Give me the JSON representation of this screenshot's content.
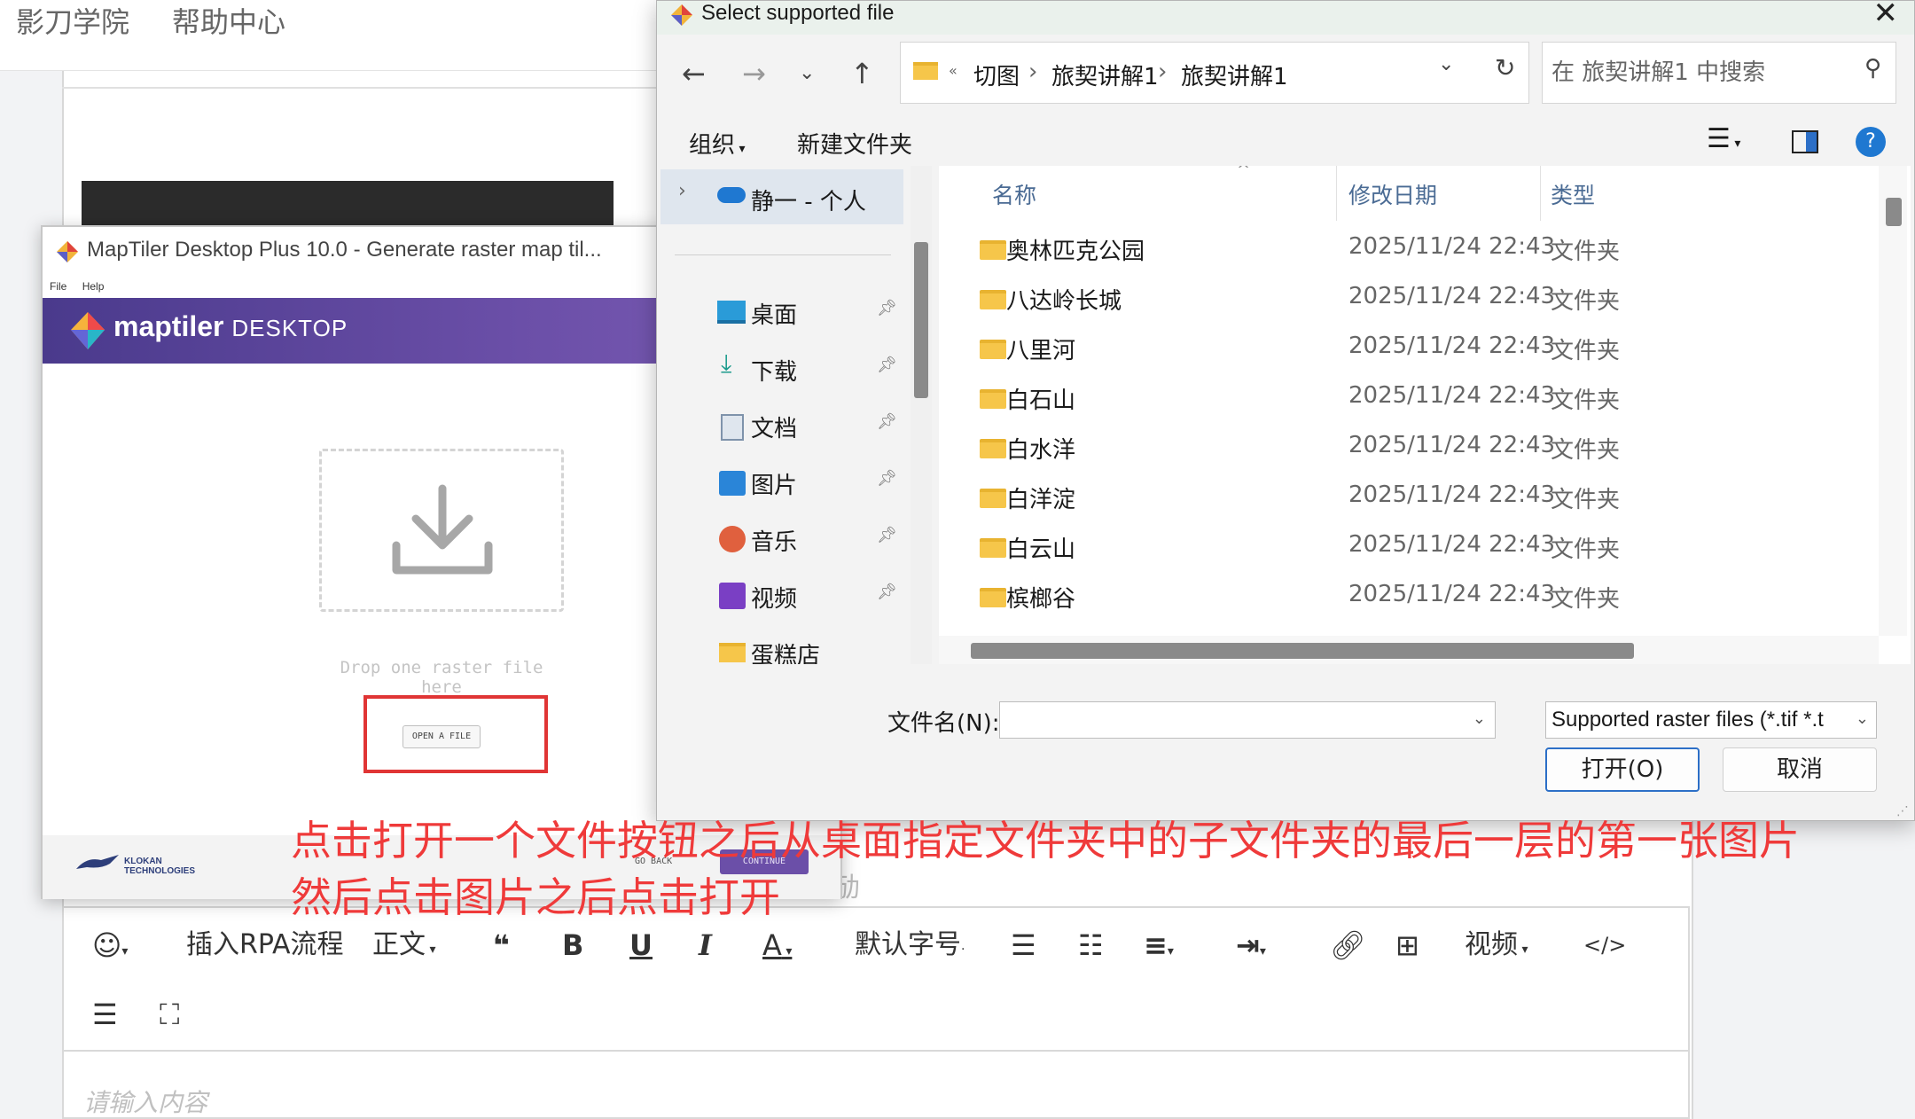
{
  "web": {
    "nav": [
      "影刀学院",
      "帮助中心"
    ],
    "editor_toolbar": {
      "emoji_icon": "smiley-icon",
      "insert_rpa": "插入RPA流程",
      "paragraph": "正文",
      "quote_icon": "❝",
      "bold": "B",
      "underline": "U",
      "italic": "I",
      "font_color": "A",
      "font_size": "默认字号",
      "video": "视频",
      "code": "</>"
    },
    "editor_placeholder": "请输入内容",
    "partial_text": "劢"
  },
  "maptiler": {
    "title": "MapTiler Desktop Plus 10.0 - Generate raster map til...",
    "menu": [
      "File",
      "Help"
    ],
    "brand": "maptiler",
    "brand_sub": "DESKTOP",
    "drop_text": "Drop one raster file here",
    "open_button": "OPEN A FILE",
    "vendor": "KLOKAN TECHNOLOGIES",
    "go_back": "GO BACK",
    "continue": "CONTINUE"
  },
  "dialog": {
    "title": "Select supported file",
    "breadcrumb": [
      "切图",
      "旅契讲解1",
      "旅契讲解1"
    ],
    "search_placeholder": "在 旅契讲解1 中搜索",
    "organize": "组织",
    "new_folder": "新建文件夹",
    "nav_pane": {
      "onedrive": "静一 - 个人",
      "items": [
        {
          "label": "桌面",
          "icon": "desktop-icon"
        },
        {
          "label": "下载",
          "icon": "download-icon"
        },
        {
          "label": "文档",
          "icon": "document-icon"
        },
        {
          "label": "图片",
          "icon": "pictures-icon"
        },
        {
          "label": "音乐",
          "icon": "music-icon"
        },
        {
          "label": "视频",
          "icon": "video-icon"
        },
        {
          "label": "蛋糕店",
          "icon": "folder-icon"
        }
      ]
    },
    "columns": [
      "名称",
      "修改日期",
      "类型"
    ],
    "rows": [
      {
        "name": "奥林匹克公园",
        "date": "2025/11/24 22:43",
        "type": "文件夹"
      },
      {
        "name": "八达岭长城",
        "date": "2025/11/24 22:43",
        "type": "文件夹"
      },
      {
        "name": "八里河",
        "date": "2025/11/24 22:43",
        "type": "文件夹"
      },
      {
        "name": "白石山",
        "date": "2025/11/24 22:43",
        "type": "文件夹"
      },
      {
        "name": "白水洋",
        "date": "2025/11/24 22:43",
        "type": "文件夹"
      },
      {
        "name": "白洋淀",
        "date": "2025/11/24 22:43",
        "type": "文件夹"
      },
      {
        "name": "白云山",
        "date": "2025/11/24 22:43",
        "type": "文件夹"
      },
      {
        "name": "槟榔谷",
        "date": "2025/11/24 22:43",
        "type": "文件夹"
      }
    ],
    "filename_label": "文件名(N):",
    "filename_value": "",
    "filetype": "Supported raster files (*.tif *.t",
    "open_button": "打开(O)",
    "cancel_button": "取消"
  },
  "annotation": {
    "line1": "点击打开一个文件按钮之后从桌面指定文件夹中的子文件夹的最后一层的第一张图片",
    "line2": "然后点击图片之后点击打开",
    "color": "#ef3a3a"
  }
}
